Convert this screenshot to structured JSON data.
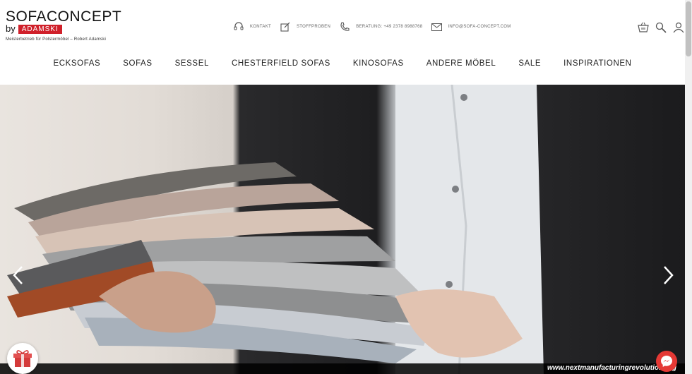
{
  "logo": {
    "main": "SOFACONCEPT",
    "by": "by",
    "brand": "ADAMSKI",
    "tagline": "Meisterbetrieb für Polstermöbel – Robert Adamski"
  },
  "topbar": {
    "contact": "KONTAKT",
    "samples": "STOFFPROBEN",
    "consult": "BERATUNG: +49 2378 8988768",
    "email": "INFO@SOFA-CONCEPT.COM"
  },
  "nav": {
    "items": [
      "ECKSOFAS",
      "SOFAS",
      "SESSEL",
      "CHESTERFIELD SOFAS",
      "KINOSOFAS",
      "ANDERE MÖBEL",
      "SALE",
      "INSPIRATIONEN"
    ]
  },
  "watermark": "www.nextmanufacturingrevolution.org",
  "colors": {
    "brand_red": "#d0202a",
    "messenger": "#e53935"
  }
}
